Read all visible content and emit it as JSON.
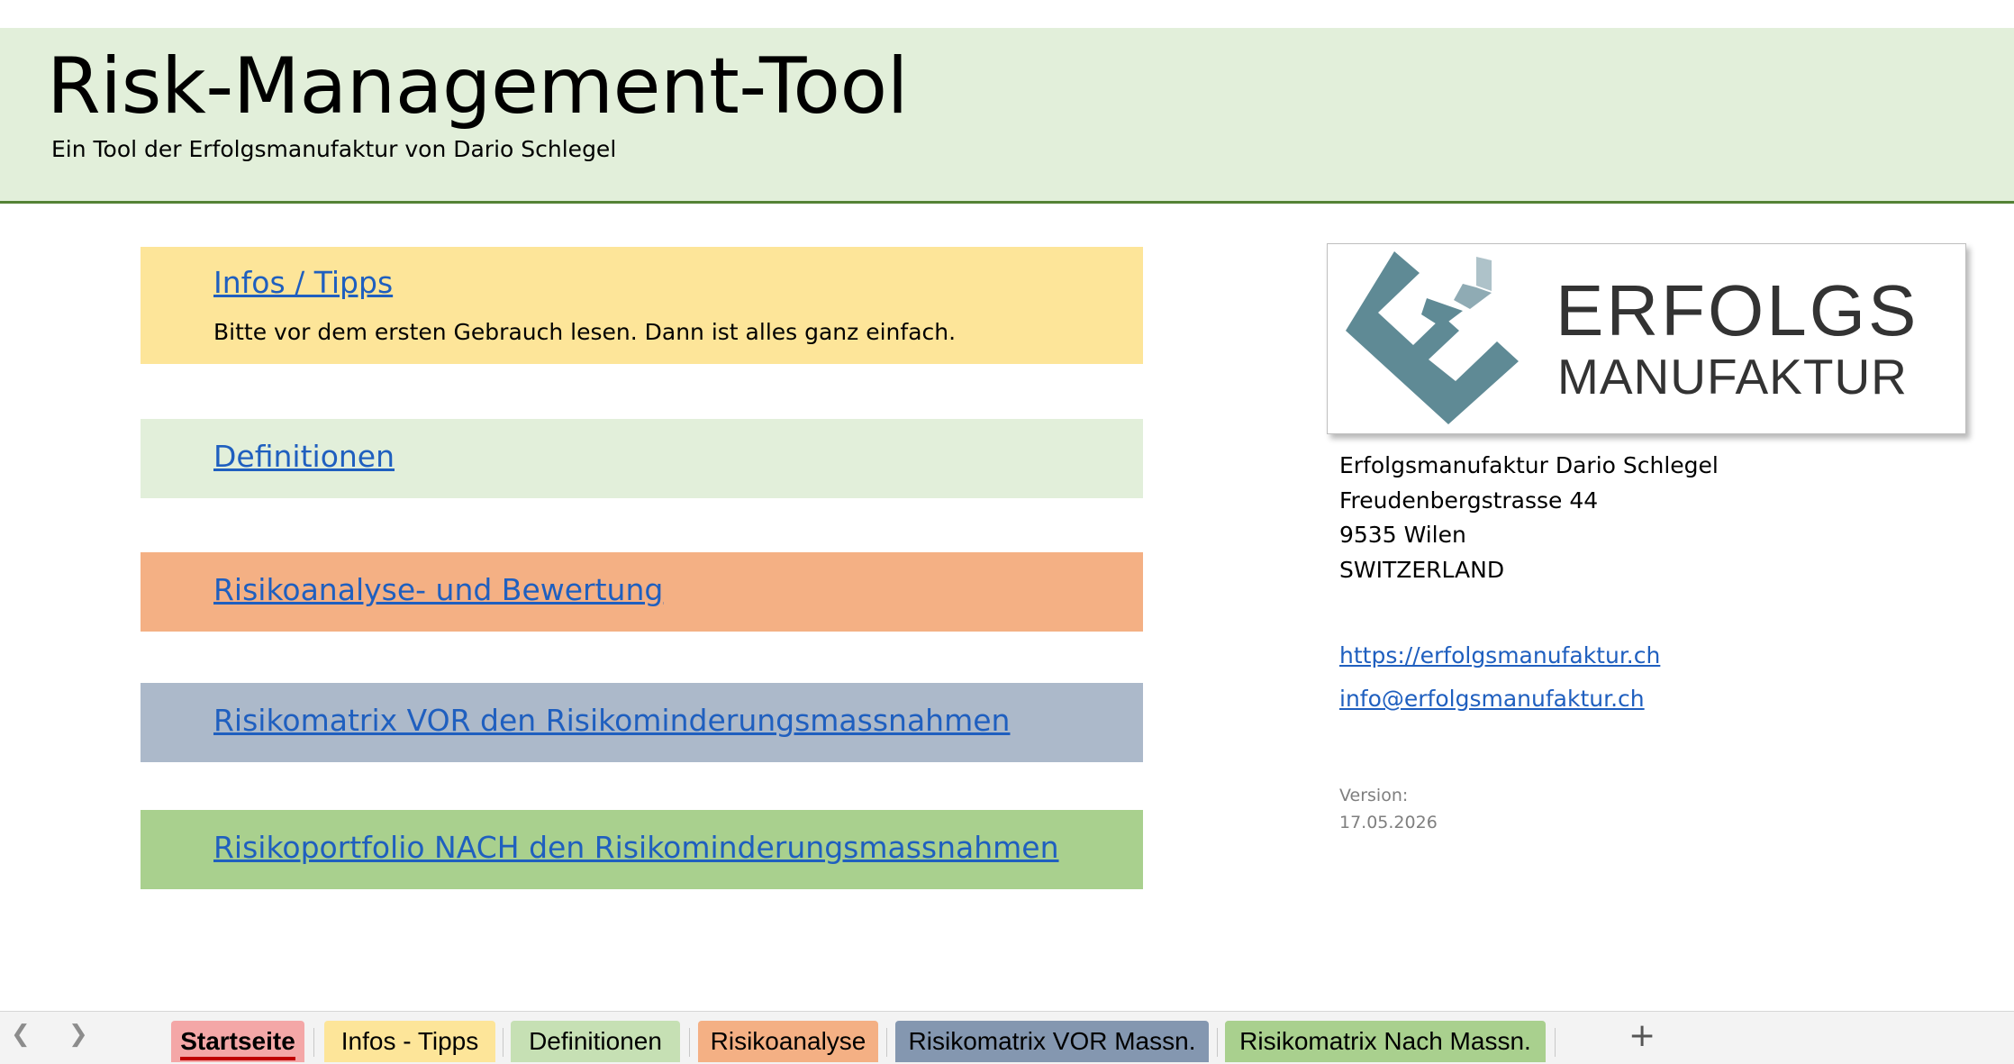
{
  "header": {
    "title": "Risk-Management-Tool",
    "subtitle": "Ein Tool der Erfolgsmanufaktur von Dario Schlegel"
  },
  "panels": {
    "infos": {
      "link": "Infos / Tipps",
      "desc": "Bitte vor dem ersten Gebrauch lesen. Dann ist alles ganz einfach."
    },
    "definitionen": {
      "link": "Definitionen"
    },
    "risikoanalyse": {
      "link": "Risikoanalyse- und Bewertung"
    },
    "matrix_vor": {
      "link": "Risikomatrix VOR den Risikominderungsmassnahmen"
    },
    "portfolio_nach": {
      "link": "Risikoportfolio NACH den Risikominderungsmassnahmen"
    }
  },
  "logo": {
    "line1": "ERFOLGS",
    "line2": "MANUFAKTUR"
  },
  "contact": {
    "name": "Erfolgsmanufaktur Dario Schlegel",
    "street": "Freudenbergstrasse 44",
    "city": "9535 Wilen",
    "country": "SWITZERLAND",
    "website": "https://erfolgsmanufaktur.ch",
    "email": "info@erfolgsmanufaktur.ch",
    "version_label": "Version:",
    "version_date": "17.05.2026"
  },
  "sheet_tabs": [
    {
      "label": "Startseite",
      "color": "#f4a7a7"
    },
    {
      "label": "Infos - Tipps",
      "color": "#fde599"
    },
    {
      "label": "Definitionen",
      "color": "#c6e0b4"
    },
    {
      "label": "Risikoanalyse",
      "color": "#f4b084"
    },
    {
      "label": "Risikomatrix VOR Massn.",
      "color": "#8497b0"
    },
    {
      "label": "Risikomatrix Nach Massn.",
      "color": "#a9d08e"
    }
  ],
  "colors": {
    "header_bg": "#e2efda",
    "header_line": "#548235",
    "link": "#1f5fbf",
    "logo_teal": "#5f8a95"
  }
}
